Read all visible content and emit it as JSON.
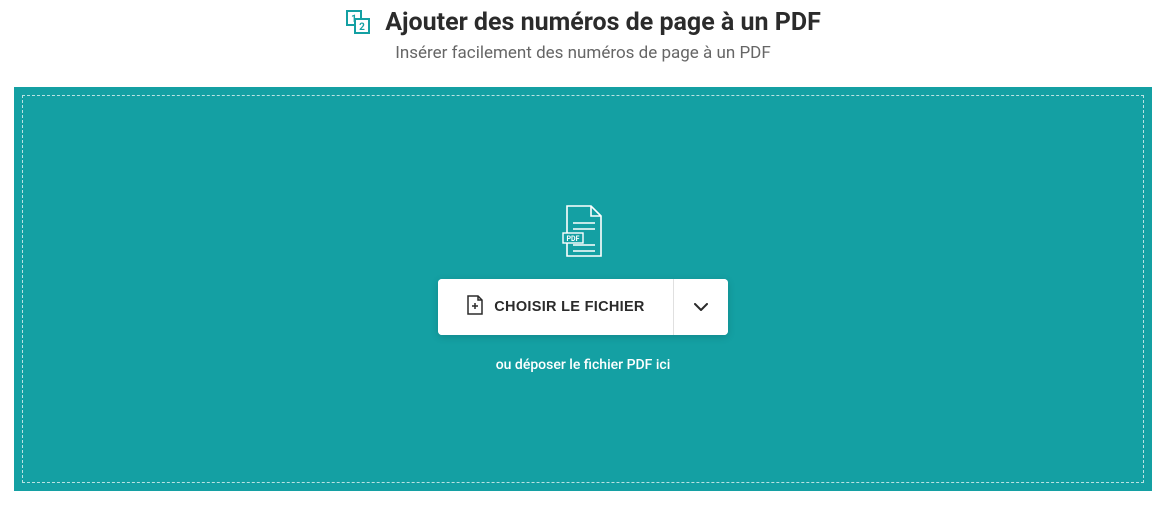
{
  "header": {
    "title": "Ajouter des numéros de page à un PDF",
    "subtitle": "Insérer facilement des numéros de page à un PDF"
  },
  "dropzone": {
    "choose_label": "CHOISIR LE FICHIER",
    "drop_hint": "ou déposer le fichier PDF ici",
    "file_badge": "PDF"
  },
  "colors": {
    "accent": "#14a0a3",
    "text_dark": "#2b2b2b",
    "text_muted": "#666666"
  }
}
